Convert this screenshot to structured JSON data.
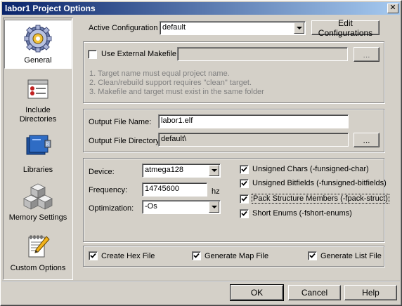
{
  "window": {
    "title": "labor1 Project Options",
    "close_glyph": "✕"
  },
  "sidebar": {
    "items": [
      {
        "label": "General",
        "icon": "gear-icon"
      },
      {
        "label": "Include Directories",
        "icon": "folder-list-icon"
      },
      {
        "label": "Libraries",
        "icon": "books-icon"
      },
      {
        "label": "Memory Settings",
        "icon": "blocks-icon"
      },
      {
        "label": "Custom Options",
        "icon": "notepad-pencil-icon"
      }
    ]
  },
  "config": {
    "label": "Active Configuration",
    "value": "default",
    "edit_button": "Edit Configurations"
  },
  "makefile": {
    "checkbox_label": "Use External Makefile",
    "checked": false,
    "path_value": "",
    "browse_label": "...",
    "notes": [
      "1. Target name must equal project name.",
      "2. Clean/rebuild support requires \"clean\" target.",
      "3. Makefile and target must exist in the same folder"
    ]
  },
  "output": {
    "name_label": "Output File Name:",
    "name_value": "labor1.elf",
    "dir_label": "Output File Directory:",
    "dir_value": "default\\",
    "browse_label": "..."
  },
  "device": {
    "device_label": "Device:",
    "device_value": "atmega128",
    "freq_label": "Frequency:",
    "freq_value": "14745600",
    "freq_unit": "hz",
    "opt_label": "Optimization:",
    "opt_value": "-Os",
    "flags": [
      {
        "label": "Unsigned Chars (-funsigned-char)",
        "checked": true
      },
      {
        "label": "Unsigned Bitfields (-funsigned-bitfields)",
        "checked": true
      },
      {
        "label": "Pack Structure Members (-fpack-struct)",
        "checked": true
      },
      {
        "label": "Short Enums (-fshort-enums)",
        "checked": true
      }
    ]
  },
  "outputs": {
    "hex": {
      "label": "Create Hex File",
      "checked": true
    },
    "map": {
      "label": "Generate Map File",
      "checked": true
    },
    "list": {
      "label": "Generate List File",
      "checked": true
    }
  },
  "buttons": {
    "ok": "OK",
    "cancel": "Cancel",
    "help": "Help"
  }
}
